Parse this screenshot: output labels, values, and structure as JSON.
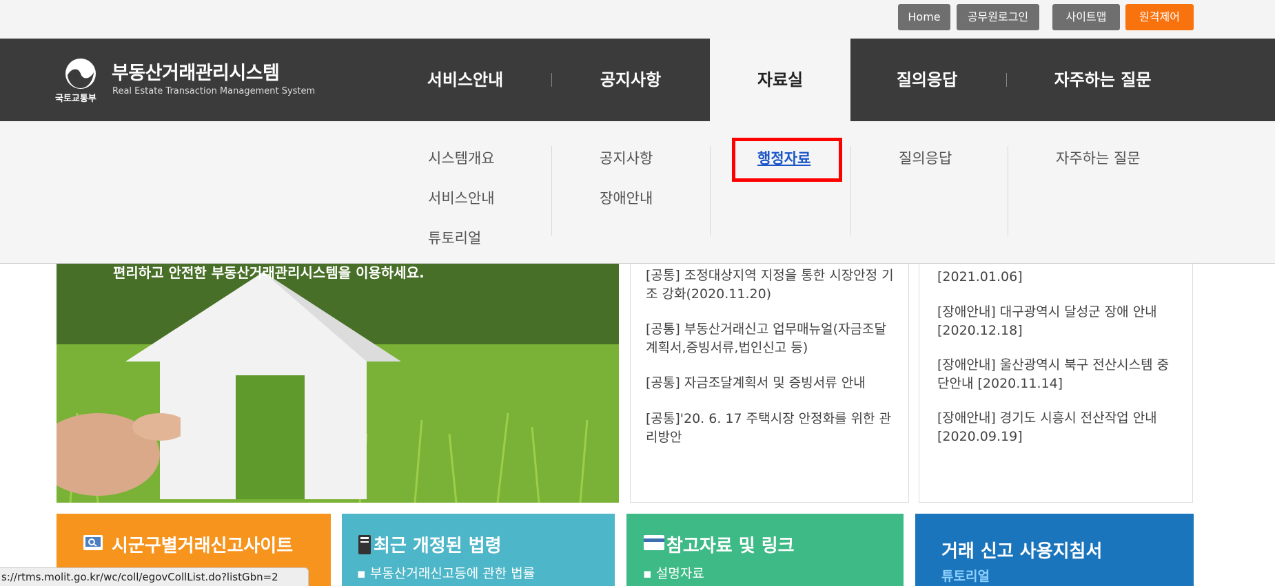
{
  "topbar": {
    "home": "Home",
    "login": "공무원로그인",
    "sitemap": "사이트맵",
    "remote": "원격제어"
  },
  "logo": {
    "ministry": "국토교통부",
    "title": "부동산거래관리시스템",
    "subtitle": "Real Estate Transaction Management System"
  },
  "nav": {
    "items": [
      {
        "label": "서비스안내"
      },
      {
        "label": "공지사항"
      },
      {
        "label": "자료실"
      },
      {
        "label": "질의응답"
      },
      {
        "label": "자주하는 질문"
      }
    ]
  },
  "dropdown": {
    "col1": [
      "시스템개요",
      "서비스안내",
      "튜토리얼"
    ],
    "col2": [
      "공지사항",
      "장애안내"
    ],
    "col3": [
      "행정자료"
    ],
    "col4": [
      "질의응답"
    ],
    "col5": [
      "자주하는 질문"
    ]
  },
  "banner": {
    "text": "편리하고 안전한 부동산거래관리시스템을 이용하세요."
  },
  "news_left": [
    "[공통] 조정대상지역 지정을 통한 시장안정 기조 강화(2020.11.20)",
    "[공통] 부동산거래신고 업무매뉴얼(자금조달계획서,증빙서류,법인신고 등)",
    "[공통] 자금조달계획서 및 증빙서류 안내",
    "[공통]'20. 6. 17 주택시장 안정화를 위한 관리방안"
  ],
  "news_right": [
    "[2021.01.06]",
    "[장애안내] 대구광역시 달성군 장애 안내 [2020.12.18]",
    "[장애안내] 울산광역시 북구 전산시스템 중단안내 [2020.11.14]",
    "[장애안내] 경기도 시흥시 전산작업 안내 [2020.09.19]"
  ],
  "tiles": [
    {
      "title": "시군구별거래신고사이트",
      "sub": "",
      "color": "#f7941d",
      "icon": "search-icon"
    },
    {
      "title": "최근 개정된 법령",
      "sub": "부동산거래신고등에 관한 법률",
      "color": "#4db6c8",
      "icon": "book-icon"
    },
    {
      "title": "참고자료 및 링크",
      "sub": "설명자료",
      "color": "#3dba85",
      "icon": "card-icon"
    },
    {
      "title": "거래 신고 사용지침서",
      "sub": "튜토리얼",
      "color": "#1b75bc",
      "icon": ""
    }
  ],
  "colors": {
    "header_bg": "#3b3b3b",
    "accent_orange": "#f8720d",
    "highlight_red": "#ff0000",
    "link_blue": "#1a56c9"
  },
  "statusbar": {
    "url": "s://rtms.molit.go.kr/wc/coll/egovCollList.do?listGbn=2"
  }
}
